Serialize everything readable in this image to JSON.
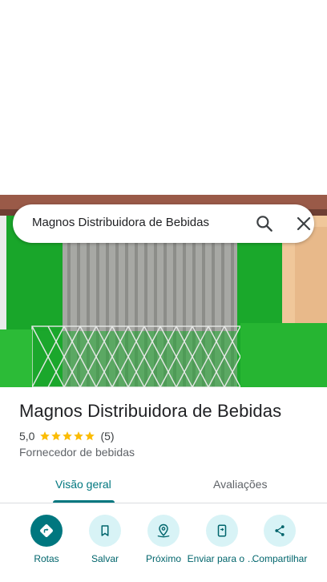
{
  "search": {
    "query": "Magnos Distribuidora de Bebidas",
    "search_icon": "search-icon",
    "close_icon": "close-icon"
  },
  "place": {
    "name": "Magnos Distribuidora de Bebidas",
    "rating": "5,0",
    "stars": 5,
    "review_count": "(5)",
    "category": "Fornecedor de bebidas"
  },
  "tabs": [
    {
      "label": "Visão geral",
      "selected": true
    },
    {
      "label": "Avaliações",
      "selected": false
    }
  ],
  "actions": [
    {
      "label": "Rotas",
      "icon": "directions-icon"
    },
    {
      "label": "Salvar",
      "icon": "bookmark-icon"
    },
    {
      "label": "Próximo",
      "icon": "nearby-icon"
    },
    {
      "label": "Enviar para o …",
      "icon": "send-to-phone-icon"
    },
    {
      "label": "Compartilhar",
      "icon": "share-icon"
    }
  ],
  "colors": {
    "accent": "#00777f",
    "action_bg": "#d8f3f6",
    "star": "#fbbc04",
    "storefront_green": "#1fae2c"
  }
}
